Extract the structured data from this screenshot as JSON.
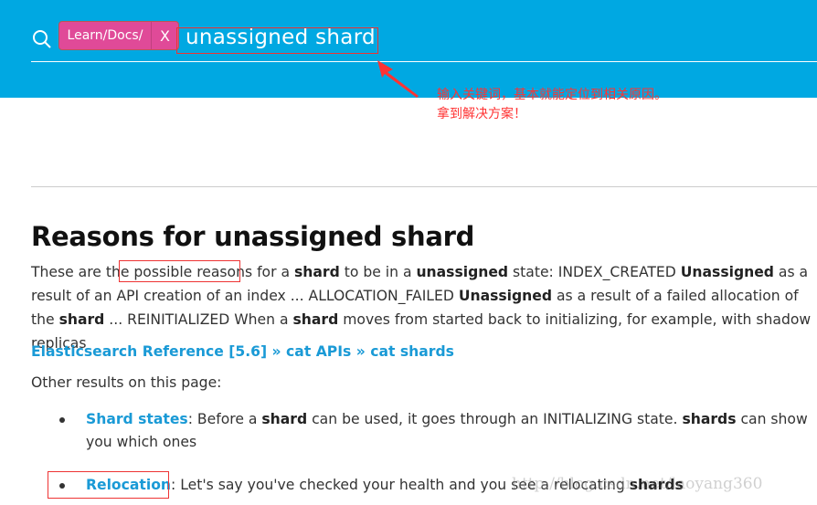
{
  "search": {
    "icon": "search-icon",
    "tag": "Learn/Docs/",
    "tag_close": "X",
    "query": "unassigned shard"
  },
  "annotation": {
    "line1": "输入关键词，基本就能定位到相关原因。",
    "line2": "拿到解决方案！",
    "color": "#ff3333"
  },
  "result": {
    "title": "Reasons for unassigned shard",
    "snippet": [
      {
        "t": "These are the "
      },
      {
        "t": "possible reasons"
      },
      {
        "t": " for a "
      },
      {
        "t": "shard",
        "b": true
      },
      {
        "t": " to be in a "
      },
      {
        "t": "unassigned",
        "b": true
      },
      {
        "t": " state: INDEX_CREATED "
      },
      {
        "t": "Unassigned",
        "b": true
      },
      {
        "t": " as a result of an API creation of an index ... ALLOCATION_FAILED "
      },
      {
        "t": "Unassigned",
        "b": true
      },
      {
        "t": " as a result of a failed allocation of the "
      },
      {
        "t": "shard",
        "b": true
      },
      {
        "t": " ... REINITIALIZED When a "
      },
      {
        "t": "shard",
        "b": true
      },
      {
        "t": " moves from started back to initializing, for example, with shadow replicas"
      }
    ],
    "breadcrumb": "Elasticsearch Reference [5.6] » cat APIs » cat shards",
    "other_label": "Other results on this page:",
    "items": [
      {
        "link": "Shard states",
        "parts": [
          {
            "t": ": Before a "
          },
          {
            "t": "shard",
            "b": true
          },
          {
            "t": " can be used, it goes through an INITIALIZING state. "
          },
          {
            "t": "shards",
            "b": true
          },
          {
            "t": " can show you which ones"
          }
        ]
      },
      {
        "link": "Relocation",
        "parts": [
          {
            "t": ": Let's say you've checked your health and you see a relocating "
          },
          {
            "t": "shards",
            "b": true
          }
        ]
      }
    ]
  },
  "watermark": "http://blog.csdn.net/laoyang360",
  "colors": {
    "header": "#00a8e2",
    "tag": "#e04a98",
    "link": "#1a9ad6"
  }
}
